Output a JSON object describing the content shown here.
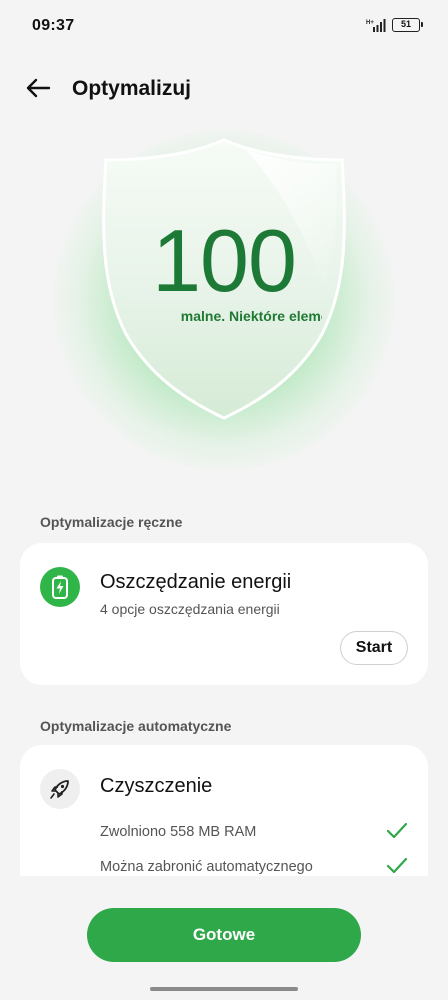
{
  "status_bar": {
    "time": "09:37",
    "network": "H+",
    "battery": "51"
  },
  "header": {
    "back_icon": "arrow-left-icon",
    "title": "Optymalizuj"
  },
  "score": {
    "value": "100",
    "message": "malne. Niektóre elementy jesz"
  },
  "manual_section": {
    "heading": "Optymalizacje ręczne",
    "items": [
      {
        "icon": "battery-saver-icon",
        "title": "Oszczędzanie energii",
        "subtitle": "4 opcje oszczędzania energii",
        "action_label": "Start"
      }
    ]
  },
  "auto_section": {
    "heading": "Optymalizacje automatyczne",
    "items": [
      {
        "icon": "rocket-icon",
        "title": "Czyszczenie",
        "checks": [
          "Zwolniono 558 MB RAM",
          "Można zabronić automatycznego"
        ]
      }
    ]
  },
  "footer": {
    "done_label": "Gotowe"
  },
  "colors": {
    "accent": "#2fa84a",
    "score": "#1d7a36",
    "background": "#f4f4f4"
  }
}
